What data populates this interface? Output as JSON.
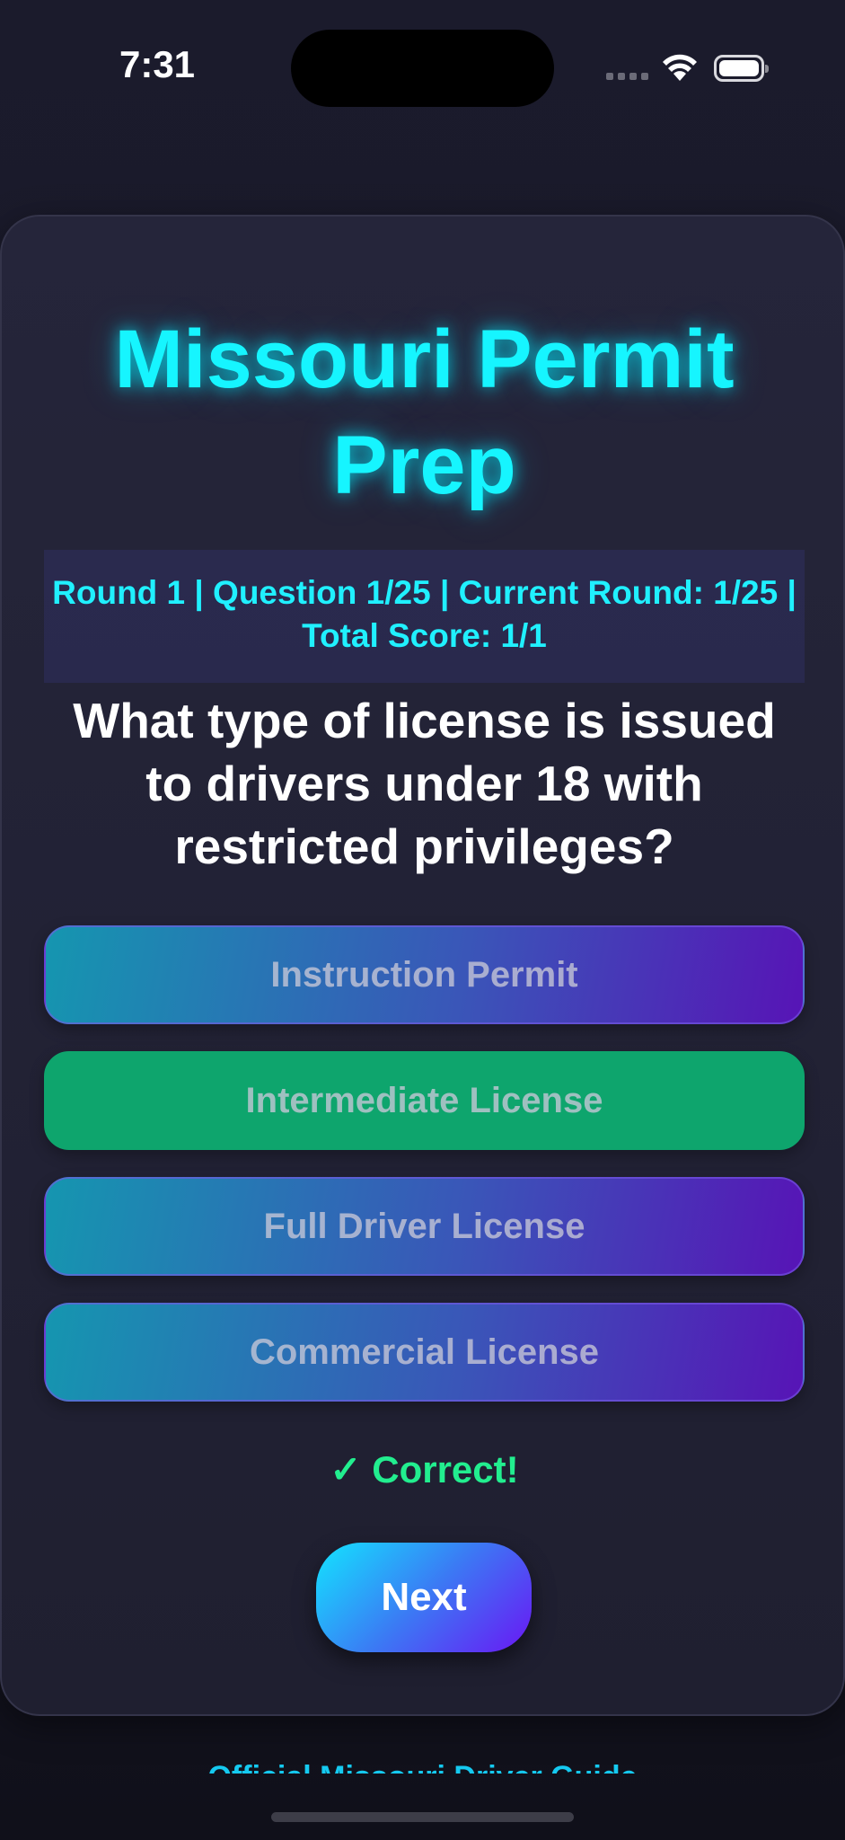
{
  "status_bar": {
    "time": "7:31",
    "icons": [
      "cellular-signal-icon",
      "wifi-icon",
      "battery-icon"
    ]
  },
  "app": {
    "title": "Missouri Permit Prep"
  },
  "stats": {
    "text": "Round 1 | Question 1/25 | Current Round: 1/25 | Total Score: 1/1"
  },
  "question": {
    "text": "What type of license is issued to drivers under 18 with restricted privileges?"
  },
  "options": [
    {
      "label": "Instruction Permit",
      "state": "disabled"
    },
    {
      "label": "Intermediate License",
      "state": "correct"
    },
    {
      "label": "Full Driver License",
      "state": "disabled"
    },
    {
      "label": "Commercial License",
      "state": "disabled"
    }
  ],
  "feedback": {
    "text": "✓ Correct!",
    "color": "#22ee8f"
  },
  "next_button": {
    "label": "Next"
  },
  "footer": {
    "link_text": "Official Missouri Driver Guide"
  },
  "colors": {
    "accent_cyan": "#16f5ff",
    "correct_green": "#0ea56d",
    "option_gradient_start": "#1596b0",
    "option_gradient_end": "#5714b6",
    "background": "#1b1b2c"
  }
}
